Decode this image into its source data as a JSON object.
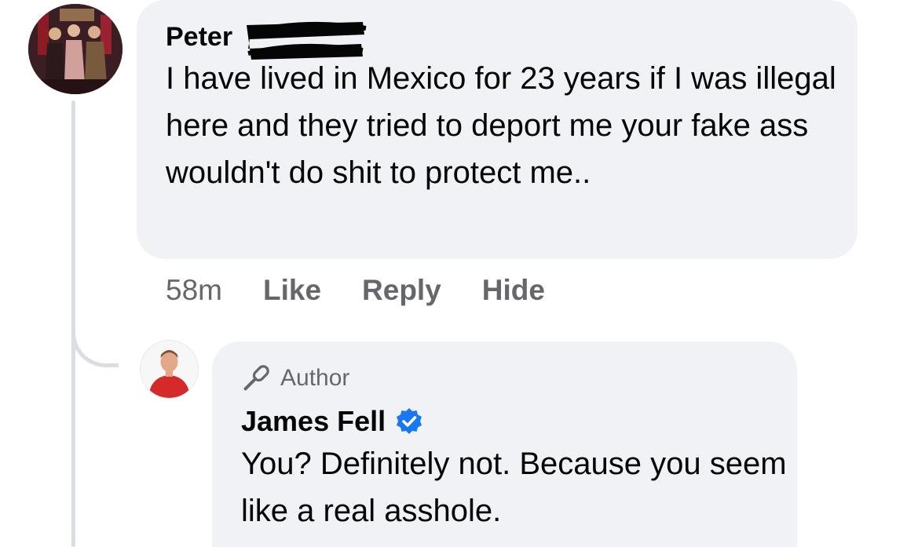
{
  "comment": {
    "author_name": "Peter",
    "text": "I have lived in Mexico for 23 years if I was illegal here and they tried to deport me your fake ass wouldn't do shit to protect me..",
    "timestamp": "58m",
    "actions": {
      "like": "Like",
      "reply": "Reply",
      "hide": "Hide"
    }
  },
  "reply": {
    "badge_label": "Author",
    "badge_icon": "microphone-icon",
    "author_name": "James Fell",
    "verified_icon": "verified-badge-icon",
    "text": "You? Definitely not. Because you seem like a real asshole."
  },
  "colors": {
    "bubble": "#f0f2f5",
    "secondary_text": "#65676b",
    "verified": "#1877f2",
    "thread_line": "#dadde1"
  }
}
